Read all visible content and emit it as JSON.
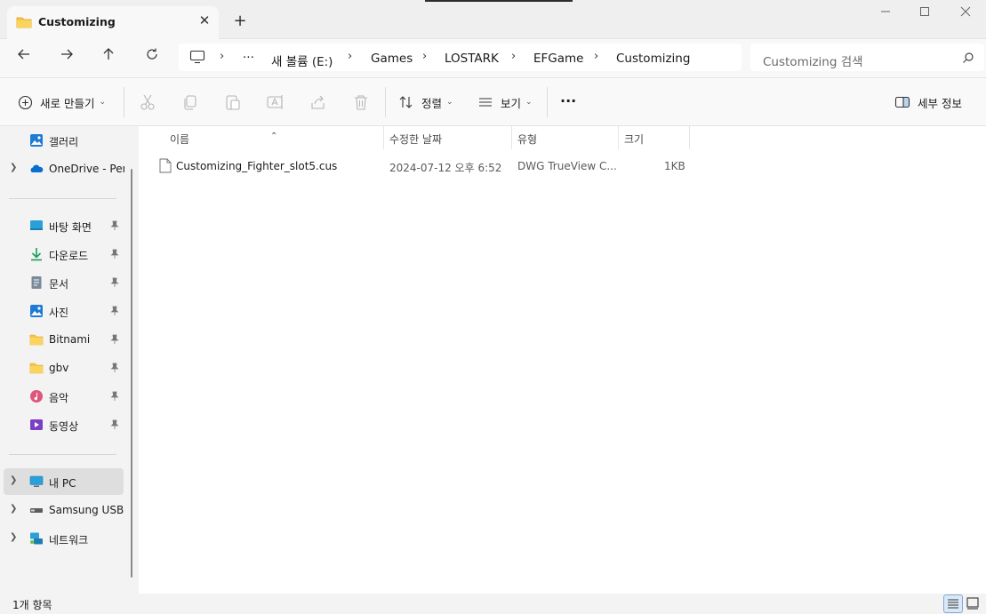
{
  "window": {
    "tab_title": "Customizing",
    "new_tab": "+",
    "close": "✕"
  },
  "address": {
    "overflow": "···",
    "crumbs": [
      "새 볼륨 (E:)",
      "Games",
      "LOSTARK",
      "EFGame",
      "Customizing"
    ],
    "search_placeholder": "Customizing 검색"
  },
  "toolbar": {
    "new_label": "새로 만들기",
    "sort_label": "정렬",
    "view_label": "보기",
    "more": "···",
    "details_label": "세부 정보"
  },
  "sidebar": {
    "items": [
      {
        "label": "갤러리"
      },
      {
        "label": "OneDrive - Pers"
      },
      {
        "label": "바탕 화면"
      },
      {
        "label": "다운로드"
      },
      {
        "label": "문서"
      },
      {
        "label": "사진"
      },
      {
        "label": "Bitnami"
      },
      {
        "label": "gbv"
      },
      {
        "label": "음악"
      },
      {
        "label": "동영상"
      },
      {
        "label": "내 PC"
      },
      {
        "label": "Samsung USB ("
      },
      {
        "label": "네트워크"
      }
    ]
  },
  "columns": {
    "name": "이름",
    "modified": "수정한 날짜",
    "type": "유형",
    "size": "크기"
  },
  "files": [
    {
      "name": "Customizing_Fighter_slot5.cus",
      "modified": "2024-07-12 오후 6:52",
      "type": "DWG TrueView C...",
      "size": "1KB"
    }
  ],
  "status": {
    "count": "1개 항목"
  },
  "colors": {
    "folder": "#f7c548",
    "accent": "#0067c0"
  }
}
